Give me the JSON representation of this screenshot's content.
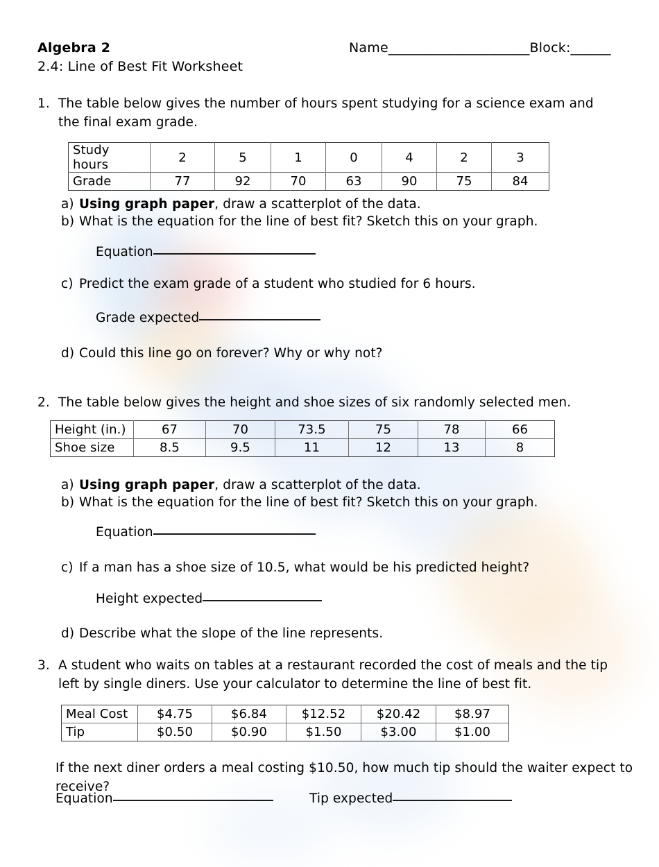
{
  "header": {
    "course": "Algebra 2",
    "worksheet_title": "2.4:  Line of Best Fit Worksheet",
    "name_block_line": "Name_____________________Block:______"
  },
  "colors": {
    "ink": "#000000",
    "table_border": "#6f6f6f",
    "rule": "#1a1a1a",
    "watermark_blue": "#bcd4ec",
    "watermark_orange": "#f3d9b8",
    "watermark_red": "#f0c5c0"
  },
  "questions": [
    {
      "number": "1.",
      "prompt": "The table below gives the number of hours spent studying for a science exam and the final exam grade.",
      "table": {
        "rows": [
          {
            "label": "Study hours",
            "values": [
              "2",
              "5",
              "1",
              "0",
              "4",
              "2",
              "3"
            ]
          },
          {
            "label": "Grade",
            "values": [
              "77",
              "92",
              "70",
              "63",
              "90",
              "75",
              "84"
            ]
          }
        ]
      },
      "parts": [
        {
          "label": "a)",
          "bold_lead": "Using graph paper",
          "text": ", draw a scatterplot of the data."
        },
        {
          "label": "b)",
          "bold_lead": "",
          "text": "What is the equation for the line of best fit?  Sketch this on your graph."
        },
        {
          "label": "c)",
          "bold_lead": "",
          "text": "Predict the exam grade of a student who studied for 6 hours."
        },
        {
          "label": "d)",
          "bold_lead": "",
          "text": "Could this line go on forever?  Why or why not?"
        }
      ],
      "answer_equation_label": "Equation",
      "answer_predict_label": "Grade expected"
    },
    {
      "number": "2.",
      "prompt": "The table below gives the height and shoe sizes of six randomly selected men.",
      "table": {
        "rows": [
          {
            "label": "Height (in.)",
            "values": [
              "67",
              "70",
              "73.5",
              "75",
              "78",
              "66"
            ]
          },
          {
            "label": "Shoe size",
            "values": [
              "8.5",
              "9.5",
              "11",
              "12",
              "13",
              "8"
            ]
          }
        ]
      },
      "parts": [
        {
          "label": "a)",
          "bold_lead": "Using graph paper",
          "text": ", draw a scatterplot of the data."
        },
        {
          "label": "b)",
          "bold_lead": "",
          "text": "What is the equation for the line of best fit?  Sketch this on your graph."
        },
        {
          "label": "c)",
          "bold_lead": "",
          "text": "If a man has a shoe size of 10.5, what would be his predicted height?"
        },
        {
          "label": "d)",
          "bold_lead": "",
          "text": "Describe what the slope of the line represents."
        }
      ],
      "answer_equation_label": "Equation",
      "answer_predict_label": "Height expected"
    },
    {
      "number": "3.",
      "prompt": "A student who waits on tables at a restaurant recorded the cost of meals and the tip left by single diners.  Use your calculator to determine the line of best fit.",
      "table": {
        "rows": [
          {
            "label": "Meal Cost",
            "values": [
              "$4.75",
              "$6.84",
              "$12.52",
              "$20.42",
              "$8.97"
            ]
          },
          {
            "label": "Tip",
            "values": [
              "$0.50",
              "$0.90",
              "$1.50",
              "$3.00",
              "$1.00"
            ]
          }
        ]
      },
      "closing_prompt": "If the next diner orders a meal costing $10.50, how much tip should the waiter expect to receive?",
      "answer_equation_label": "Equation",
      "answer_predict_label": "Tip expected"
    }
  ]
}
